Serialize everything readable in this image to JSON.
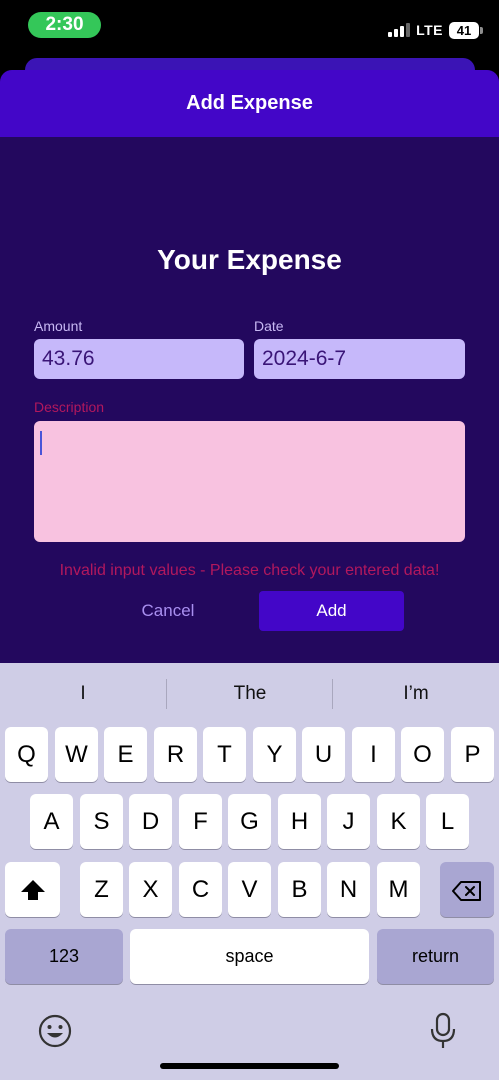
{
  "status": {
    "time": "2:30",
    "network": "LTE",
    "battery": "41"
  },
  "sheet": {
    "title": "Add Expense"
  },
  "form": {
    "title": "Your Expense",
    "amount_label": "Amount",
    "amount_value": "43.76",
    "date_label": "Date",
    "date_value": "2024-6-7",
    "description_label": "Description",
    "description_value": "",
    "error": "Invalid input values - Please check your entered data!",
    "cancel_label": "Cancel",
    "add_label": "Add"
  },
  "keyboard": {
    "suggestions": [
      "I",
      "The",
      "I’m"
    ],
    "row1": [
      "Q",
      "W",
      "E",
      "R",
      "T",
      "Y",
      "U",
      "I",
      "O",
      "P"
    ],
    "row2": [
      "A",
      "S",
      "D",
      "F",
      "G",
      "H",
      "J",
      "K",
      "L"
    ],
    "row3": [
      "Z",
      "X",
      "C",
      "V",
      "B",
      "N",
      "M"
    ],
    "numbers_label": "123",
    "space_label": "space",
    "return_label": "return",
    "icons": [
      "shift-icon",
      "backspace-icon",
      "emoji-icon",
      "microphone-icon"
    ]
  },
  "colors": {
    "header": "#4306c8",
    "background": "#23085e",
    "input": "#c6b8fa",
    "description_input": "#f8c2e0",
    "error": "#b2185d",
    "status_pill": "#34c759"
  }
}
